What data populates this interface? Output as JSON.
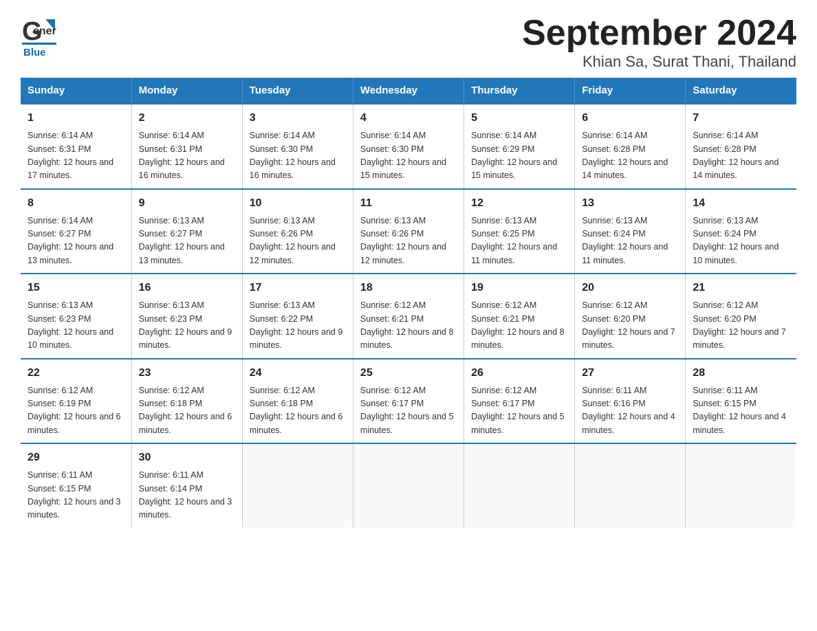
{
  "header": {
    "logo_general": "General",
    "logo_blue": "Blue",
    "title": "September 2024",
    "subtitle": "Khian Sa, Surat Thani, Thailand"
  },
  "days_of_week": [
    "Sunday",
    "Monday",
    "Tuesday",
    "Wednesday",
    "Thursday",
    "Friday",
    "Saturday"
  ],
  "weeks": [
    [
      {
        "day": "1",
        "sunrise": "Sunrise: 6:14 AM",
        "sunset": "Sunset: 6:31 PM",
        "daylight": "Daylight: 12 hours and 17 minutes."
      },
      {
        "day": "2",
        "sunrise": "Sunrise: 6:14 AM",
        "sunset": "Sunset: 6:31 PM",
        "daylight": "Daylight: 12 hours and 16 minutes."
      },
      {
        "day": "3",
        "sunrise": "Sunrise: 6:14 AM",
        "sunset": "Sunset: 6:30 PM",
        "daylight": "Daylight: 12 hours and 16 minutes."
      },
      {
        "day": "4",
        "sunrise": "Sunrise: 6:14 AM",
        "sunset": "Sunset: 6:30 PM",
        "daylight": "Daylight: 12 hours and 15 minutes."
      },
      {
        "day": "5",
        "sunrise": "Sunrise: 6:14 AM",
        "sunset": "Sunset: 6:29 PM",
        "daylight": "Daylight: 12 hours and 15 minutes."
      },
      {
        "day": "6",
        "sunrise": "Sunrise: 6:14 AM",
        "sunset": "Sunset: 6:28 PM",
        "daylight": "Daylight: 12 hours and 14 minutes."
      },
      {
        "day": "7",
        "sunrise": "Sunrise: 6:14 AM",
        "sunset": "Sunset: 6:28 PM",
        "daylight": "Daylight: 12 hours and 14 minutes."
      }
    ],
    [
      {
        "day": "8",
        "sunrise": "Sunrise: 6:14 AM",
        "sunset": "Sunset: 6:27 PM",
        "daylight": "Daylight: 12 hours and 13 minutes."
      },
      {
        "day": "9",
        "sunrise": "Sunrise: 6:13 AM",
        "sunset": "Sunset: 6:27 PM",
        "daylight": "Daylight: 12 hours and 13 minutes."
      },
      {
        "day": "10",
        "sunrise": "Sunrise: 6:13 AM",
        "sunset": "Sunset: 6:26 PM",
        "daylight": "Daylight: 12 hours and 12 minutes."
      },
      {
        "day": "11",
        "sunrise": "Sunrise: 6:13 AM",
        "sunset": "Sunset: 6:26 PM",
        "daylight": "Daylight: 12 hours and 12 minutes."
      },
      {
        "day": "12",
        "sunrise": "Sunrise: 6:13 AM",
        "sunset": "Sunset: 6:25 PM",
        "daylight": "Daylight: 12 hours and 11 minutes."
      },
      {
        "day": "13",
        "sunrise": "Sunrise: 6:13 AM",
        "sunset": "Sunset: 6:24 PM",
        "daylight": "Daylight: 12 hours and 11 minutes."
      },
      {
        "day": "14",
        "sunrise": "Sunrise: 6:13 AM",
        "sunset": "Sunset: 6:24 PM",
        "daylight": "Daylight: 12 hours and 10 minutes."
      }
    ],
    [
      {
        "day": "15",
        "sunrise": "Sunrise: 6:13 AM",
        "sunset": "Sunset: 6:23 PM",
        "daylight": "Daylight: 12 hours and 10 minutes."
      },
      {
        "day": "16",
        "sunrise": "Sunrise: 6:13 AM",
        "sunset": "Sunset: 6:23 PM",
        "daylight": "Daylight: 12 hours and 9 minutes."
      },
      {
        "day": "17",
        "sunrise": "Sunrise: 6:13 AM",
        "sunset": "Sunset: 6:22 PM",
        "daylight": "Daylight: 12 hours and 9 minutes."
      },
      {
        "day": "18",
        "sunrise": "Sunrise: 6:12 AM",
        "sunset": "Sunset: 6:21 PM",
        "daylight": "Daylight: 12 hours and 8 minutes."
      },
      {
        "day": "19",
        "sunrise": "Sunrise: 6:12 AM",
        "sunset": "Sunset: 6:21 PM",
        "daylight": "Daylight: 12 hours and 8 minutes."
      },
      {
        "day": "20",
        "sunrise": "Sunrise: 6:12 AM",
        "sunset": "Sunset: 6:20 PM",
        "daylight": "Daylight: 12 hours and 7 minutes."
      },
      {
        "day": "21",
        "sunrise": "Sunrise: 6:12 AM",
        "sunset": "Sunset: 6:20 PM",
        "daylight": "Daylight: 12 hours and 7 minutes."
      }
    ],
    [
      {
        "day": "22",
        "sunrise": "Sunrise: 6:12 AM",
        "sunset": "Sunset: 6:19 PM",
        "daylight": "Daylight: 12 hours and 6 minutes."
      },
      {
        "day": "23",
        "sunrise": "Sunrise: 6:12 AM",
        "sunset": "Sunset: 6:18 PM",
        "daylight": "Daylight: 12 hours and 6 minutes."
      },
      {
        "day": "24",
        "sunrise": "Sunrise: 6:12 AM",
        "sunset": "Sunset: 6:18 PM",
        "daylight": "Daylight: 12 hours and 6 minutes."
      },
      {
        "day": "25",
        "sunrise": "Sunrise: 6:12 AM",
        "sunset": "Sunset: 6:17 PM",
        "daylight": "Daylight: 12 hours and 5 minutes."
      },
      {
        "day": "26",
        "sunrise": "Sunrise: 6:12 AM",
        "sunset": "Sunset: 6:17 PM",
        "daylight": "Daylight: 12 hours and 5 minutes."
      },
      {
        "day": "27",
        "sunrise": "Sunrise: 6:11 AM",
        "sunset": "Sunset: 6:16 PM",
        "daylight": "Daylight: 12 hours and 4 minutes."
      },
      {
        "day": "28",
        "sunrise": "Sunrise: 6:11 AM",
        "sunset": "Sunset: 6:15 PM",
        "daylight": "Daylight: 12 hours and 4 minutes."
      }
    ],
    [
      {
        "day": "29",
        "sunrise": "Sunrise: 6:11 AM",
        "sunset": "Sunset: 6:15 PM",
        "daylight": "Daylight: 12 hours and 3 minutes."
      },
      {
        "day": "30",
        "sunrise": "Sunrise: 6:11 AM",
        "sunset": "Sunset: 6:14 PM",
        "daylight": "Daylight: 12 hours and 3 minutes."
      },
      null,
      null,
      null,
      null,
      null
    ]
  ]
}
